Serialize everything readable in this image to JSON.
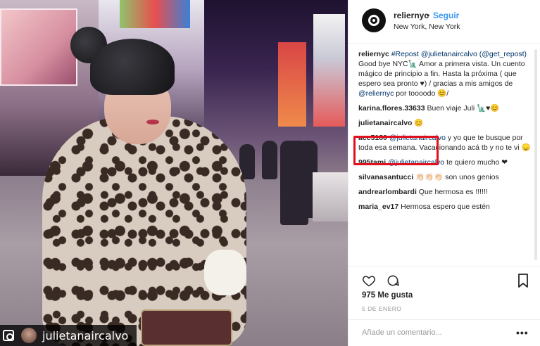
{
  "header": {
    "username": "reliernyc",
    "separator": "•",
    "follow_label": "Seguir",
    "location": "New York, New York"
  },
  "caption": {
    "username": "reliernyc",
    "text_parts": [
      {
        "t": " ",
        "m": false
      },
      {
        "t": "#Repost",
        "m": true
      },
      {
        "t": " ",
        "m": false
      },
      {
        "t": "@julietanaircalvo",
        "m": true
      },
      {
        "t": " ",
        "m": false
      },
      {
        "t": "(@get_repost)",
        "m": true
      },
      {
        "t": " Good bye NYC🗽 Amor a primera vista. Un cuento mágico de principio a fin. Hasta la próxima ( que espero sea pronto ♥) / gracias a mis amigos de ",
        "m": false
      },
      {
        "t": "@reliernyc",
        "m": true
      },
      {
        "t": " por toooodo 😊/",
        "m": false
      }
    ]
  },
  "comments": [
    {
      "username": "karina.flores.33633",
      "text": "Buen viaje Juli 🗽♥😊"
    },
    {
      "username": "julietanaircalvo",
      "text": "😊"
    },
    {
      "username": "acc5180",
      "mention": "@julietanaircalvo",
      "text": " y yo que te busque por toda esa semana. Vacacionando acá tb y no te vi 😞"
    },
    {
      "username": "995tami",
      "mention": "@julietanaircalvo",
      "text": " te quiero mucho ❤"
    },
    {
      "username": "silvanasantucci",
      "text": "👏🏻👏🏻👏🏻 son unos genios"
    },
    {
      "username": "andrearlombardi",
      "text": "Que hermosa es !!!!!!"
    },
    {
      "username": "maria_ev17",
      "text": "Hermosa espero que estén"
    }
  ],
  "likes": "975 Me gusta",
  "date": "5 DE ENERO",
  "comment_placeholder": "Añade un comentario...",
  "more_label": "•••",
  "watermark": {
    "name": "julietanaircalvo"
  },
  "colors": {
    "follow": "#3897f0",
    "highlight": "#e0101f",
    "mention": "#003569"
  },
  "icons": [
    "heart-icon",
    "comment-bubble-icon",
    "bookmark-icon",
    "more-options-icon",
    "camera-icon"
  ]
}
